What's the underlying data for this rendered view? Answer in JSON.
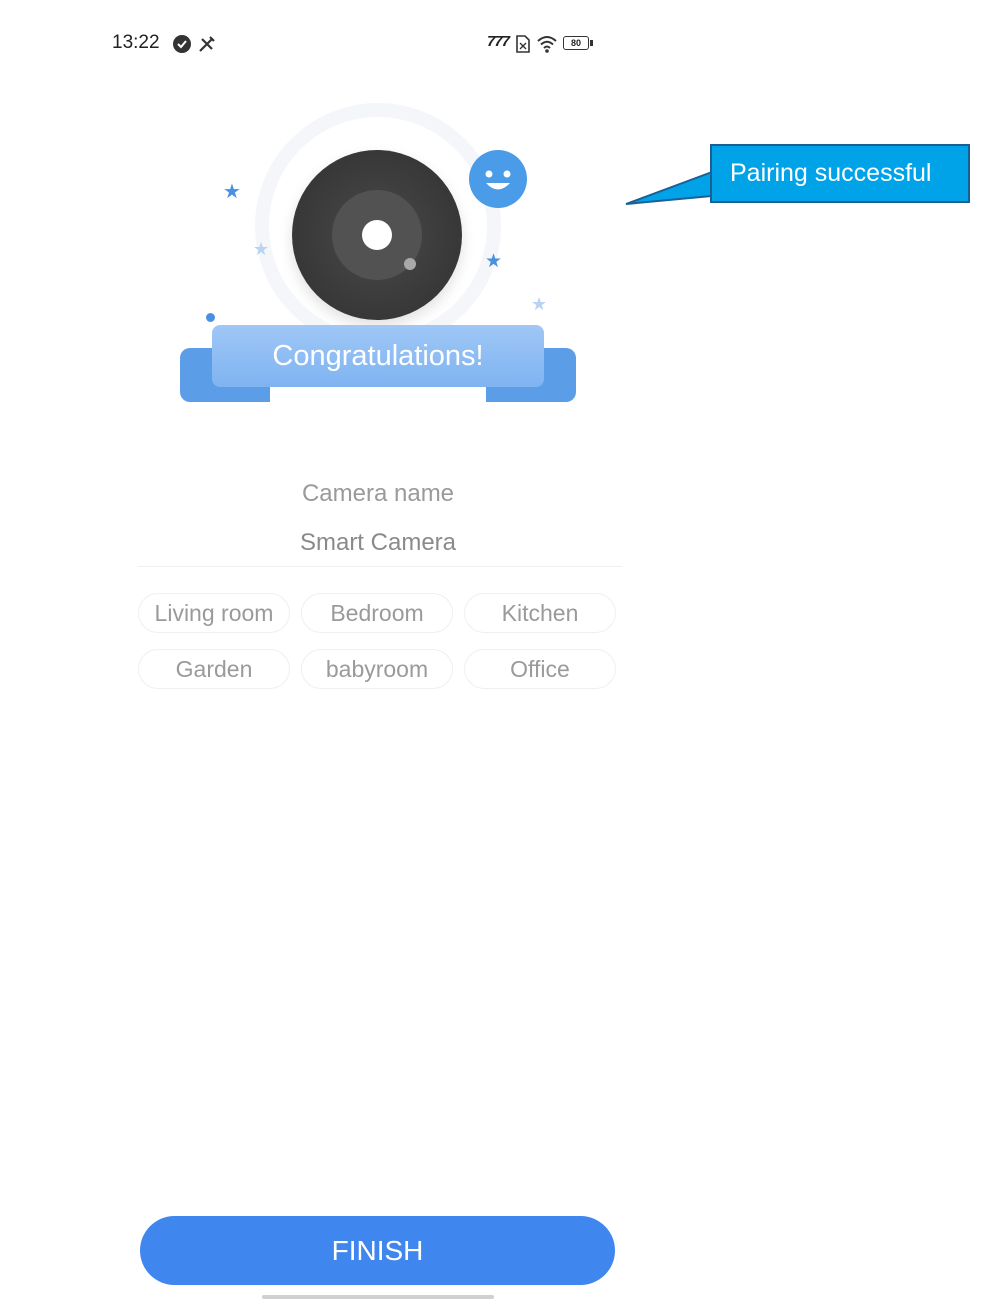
{
  "status_bar": {
    "time": "13:22",
    "left_icons": [
      "shield-check-icon",
      "tools-icon"
    ],
    "right_icons": [
      "signal-icon",
      "sim-icon",
      "wifi-icon",
      "battery-icon"
    ],
    "network_label": "777",
    "battery_level": "80"
  },
  "illustration": {
    "banner_text": "Congratulations!"
  },
  "callout": {
    "text": "Pairing successful"
  },
  "camera": {
    "name_label": "Camera name",
    "name_value": "Smart Camera"
  },
  "rooms": [
    {
      "label": "Living room"
    },
    {
      "label": "Bedroom"
    },
    {
      "label": "Kitchen"
    },
    {
      "label": "Garden"
    },
    {
      "label": "babyroom"
    },
    {
      "label": "Office"
    }
  ],
  "actions": {
    "finish_label": "FINISH"
  },
  "colors": {
    "primary": "#3f86ee",
    "callout": "#00a2e8",
    "banner": "#7fb3f1"
  }
}
